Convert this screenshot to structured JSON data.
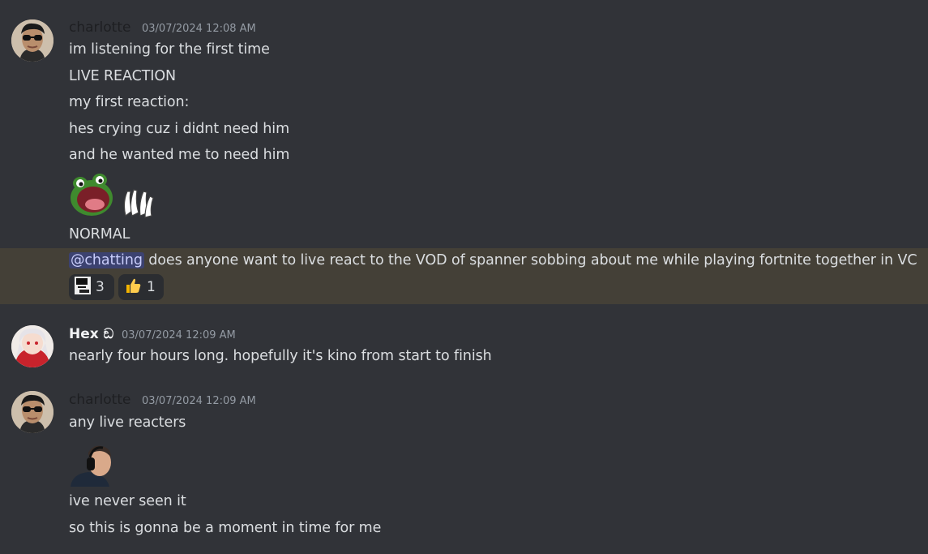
{
  "messages": [
    {
      "username": "charlotte",
      "timestamp": "03/07/2024 12:08 AM",
      "lines": [
        "im listening for the first time",
        "LIVE REACTION",
        "my first reaction:",
        "hes crying cuz i didnt need him",
        "and he wanted me to need him",
        "NORMAL"
      ],
      "emojis": [
        "frog-scream-emoji",
        "clapping-hands-emoji"
      ],
      "mention_message": {
        "mention": "@chatting",
        "text": " does anyone want to live react to the VOD of spanner sobbing about me while playing fortnite together in VC"
      },
      "reactions": [
        {
          "emoji": "meme-face-emoji",
          "count": "3"
        },
        {
          "emoji": "thumbs-up-emoji",
          "count": "1"
        }
      ]
    },
    {
      "username": "Hex",
      "username_suffix": "ඞ",
      "timestamp": "03/07/2024 12:09 AM",
      "lines": [
        "nearly four hours long. hopefully it's kino from start to finish"
      ]
    },
    {
      "username": "charlotte",
      "timestamp": "03/07/2024 12:09 AM",
      "lines": [
        "any live reacters"
      ],
      "image": "headphones-guy-emoji",
      "lines_after": [
        "ive never seen it",
        "so this is gonna be a moment in time for me"
      ]
    }
  ],
  "colors": {
    "background": "#313338",
    "highlight": "#444037",
    "mention_bg": "#3c4270",
    "mention_text": "#c9cdfb",
    "timestamp": "#949ba4",
    "charlotte_name": "#1e1f22"
  }
}
